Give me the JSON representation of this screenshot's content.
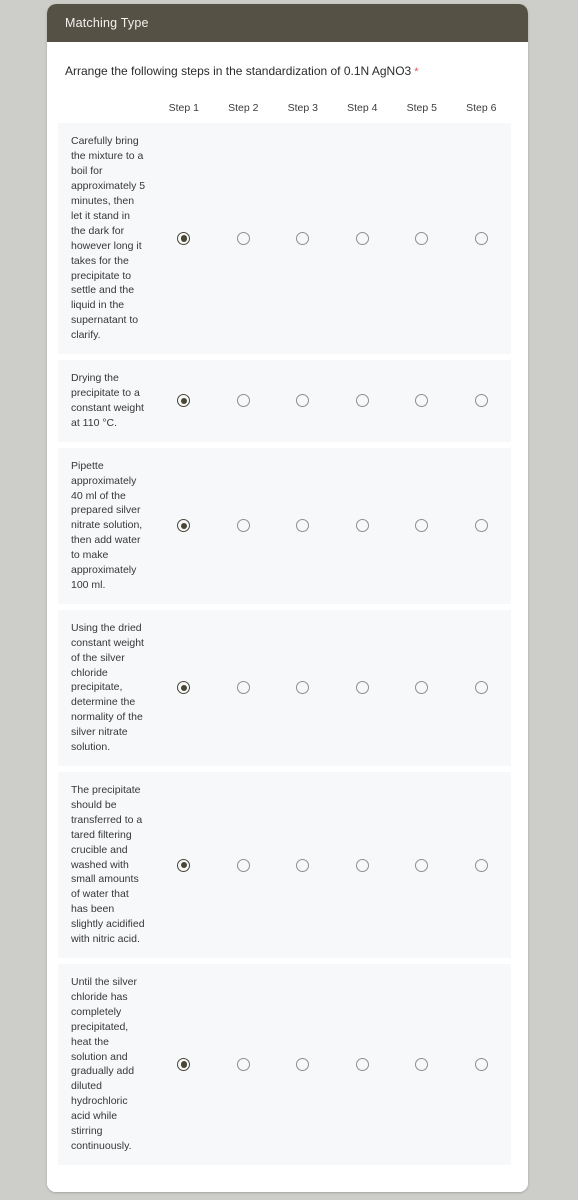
{
  "page": {
    "background_color": "#cdcdc9"
  },
  "card": {
    "header": {
      "title": "Matching Type",
      "background_color": "#565145",
      "text_color": "#f2f1ee"
    },
    "accent_color": "#4a4635",
    "required_marker": "*",
    "required_marker_color": "#e8565c",
    "row_background_color": "#f6f8f9"
  },
  "question": {
    "text": "Arrange the following steps in the standardization of 0.1N AgNO3",
    "required": true
  },
  "matrix": {
    "columns": [
      {
        "label": "Step 1"
      },
      {
        "label": "Step 2"
      },
      {
        "label": "Step 3"
      },
      {
        "label": "Step 4"
      },
      {
        "label": "Step 5"
      },
      {
        "label": "Step 6"
      }
    ],
    "rows": [
      {
        "label": "Carefully bring the mixture to a boil for approximately 5 minutes, then let it stand in the dark for however long it takes for the precipitate to settle and the liquid in the supernatant to clarify.",
        "selected_column": 0
      },
      {
        "label": "Drying the precipitate to a constant weight at 110 °C.",
        "selected_column": 0
      },
      {
        "label": "Pipette approximately 40 ml of the prepared silver nitrate solution, then add water to make approximately 100 ml.",
        "selected_column": 0
      },
      {
        "label": "Using the dried constant weight of the silver chloride precipitate, determine the normality of the silver nitrate solution.",
        "selected_column": 0
      },
      {
        "label": "The precipitate should be transferred to a tared filtering crucible and washed with small amounts of water that has been slightly acidified with nitric acid.",
        "selected_column": 0
      },
      {
        "label": "Until the silver chloride has completely precipitated, heat the solution and gradually add diluted hydrochloric acid while stirring continuously.",
        "selected_column": 0
      }
    ]
  }
}
